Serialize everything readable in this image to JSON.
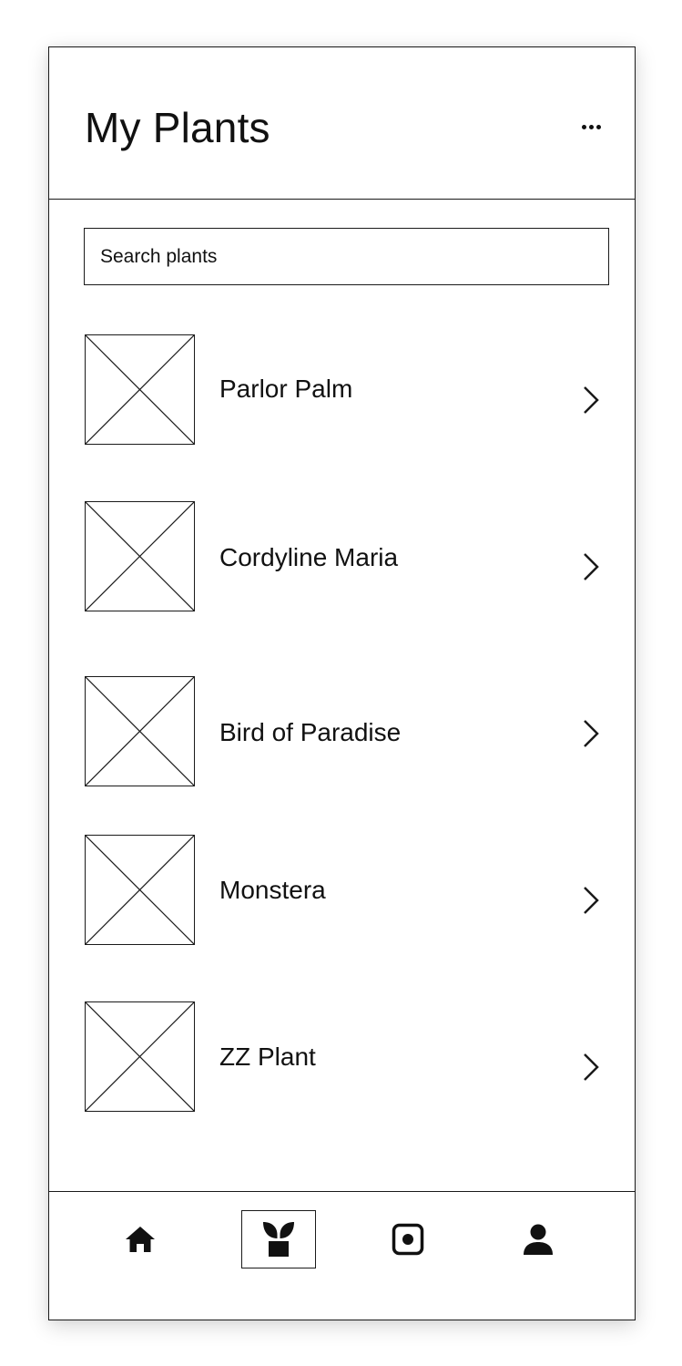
{
  "header": {
    "title": "My Plants",
    "more_icon": "more-horizontal-icon"
  },
  "search": {
    "placeholder": "Search plants",
    "value": ""
  },
  "plants": [
    {
      "name": "Parlor Palm",
      "image_icon": "image-placeholder-icon",
      "action_icon": "chevron-right-icon"
    },
    {
      "name": "Cordyline Maria",
      "image_icon": "image-placeholder-icon",
      "action_icon": "chevron-right-icon"
    },
    {
      "name": "Bird of Paradise",
      "image_icon": "image-placeholder-icon",
      "action_icon": "chevron-right-icon"
    },
    {
      "name": "Monstera",
      "image_icon": "image-placeholder-icon",
      "action_icon": "chevron-right-icon"
    },
    {
      "name": "ZZ Plant",
      "image_icon": "image-placeholder-icon",
      "action_icon": "chevron-right-icon"
    }
  ],
  "bottom_nav": {
    "items": [
      {
        "id": "home",
        "icon": "home-icon",
        "active": false
      },
      {
        "id": "plants",
        "icon": "potted-plant-icon",
        "active": true
      },
      {
        "id": "scan",
        "icon": "scan-icon",
        "active": false
      },
      {
        "id": "profile",
        "icon": "person-icon",
        "active": false
      }
    ]
  },
  "colors": {
    "line": "#1a1a1a",
    "text": "#111111",
    "background": "#ffffff"
  }
}
